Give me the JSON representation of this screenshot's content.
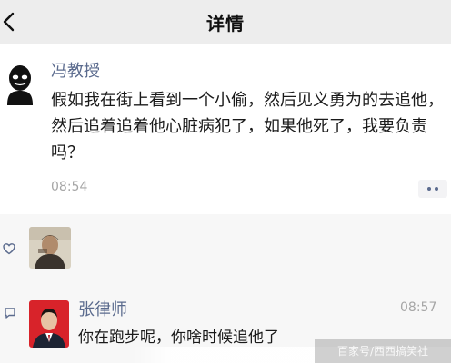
{
  "header": {
    "title": "详情",
    "back_icon": "chevron-left-icon"
  },
  "post": {
    "author": "冯教授",
    "text": "假如我在街上看到一个小偷，然后见义勇为的去追他，然后追着追着他心脏病犯了，如果他死了，我要负责吗？",
    "time": "08:54",
    "more_icon": "more-dots-icon"
  },
  "likes": {
    "icon": "heart-icon"
  },
  "comment": {
    "icon": "comment-icon",
    "author": "张律师",
    "time": "08:57",
    "text": "你在跑步呢，你啥时候追他了"
  },
  "watermark": {
    "text": "百家号/西西搞笑社"
  },
  "colors": {
    "header_bg": "#ededed",
    "name_link": "#5b6b8e",
    "time_gray": "#a6a6a6",
    "panel_bg": "#f7f7f7"
  }
}
